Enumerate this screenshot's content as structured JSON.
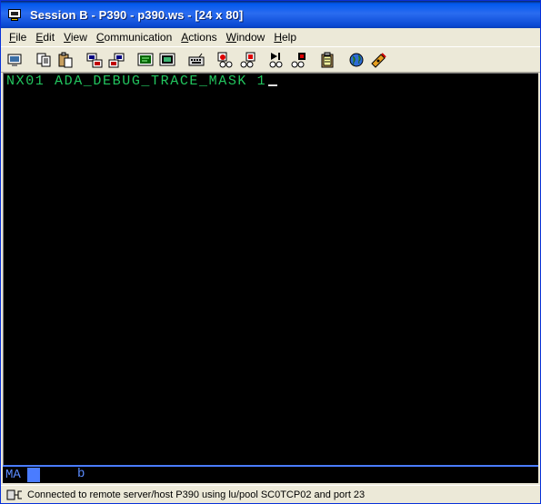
{
  "window": {
    "title": "Session B - P390 - p390.ws - [24 x 80]"
  },
  "menu": [
    {
      "pre": "",
      "ul": "F",
      "post": "ile"
    },
    {
      "pre": "",
      "ul": "E",
      "post": "dit"
    },
    {
      "pre": "",
      "ul": "V",
      "post": "iew"
    },
    {
      "pre": "",
      "ul": "C",
      "post": "ommunication"
    },
    {
      "pre": "",
      "ul": "A",
      "post": "ctions"
    },
    {
      "pre": "",
      "ul": "W",
      "post": "indow"
    },
    {
      "pre": "",
      "ul": "H",
      "post": "elp"
    }
  ],
  "toolbar": {
    "icons": [
      "print-screen-icon",
      "copy-icon",
      "paste-icon",
      "send-file-icon",
      "receive-file-icon",
      "display-setup-icon",
      "keyboard-map-icon",
      "keypad-icon",
      "record-macro-icon",
      "stop-macro-icon",
      "play-macro-icon",
      "macro-list-icon",
      "clipboard-icon",
      "web-globe-icon",
      "tools-icon"
    ]
  },
  "terminal": {
    "line1": "NX01 ADA_DEBUG_TRACE_MASK 1",
    "colors": {
      "text": "#22c55e",
      "background": "#000000"
    }
  },
  "oia": {
    "mode": "MA",
    "indicator": "b"
  },
  "status": {
    "text": "Connected to remote server/host P390 using lu/pool SC0TCP02 and port 23"
  }
}
